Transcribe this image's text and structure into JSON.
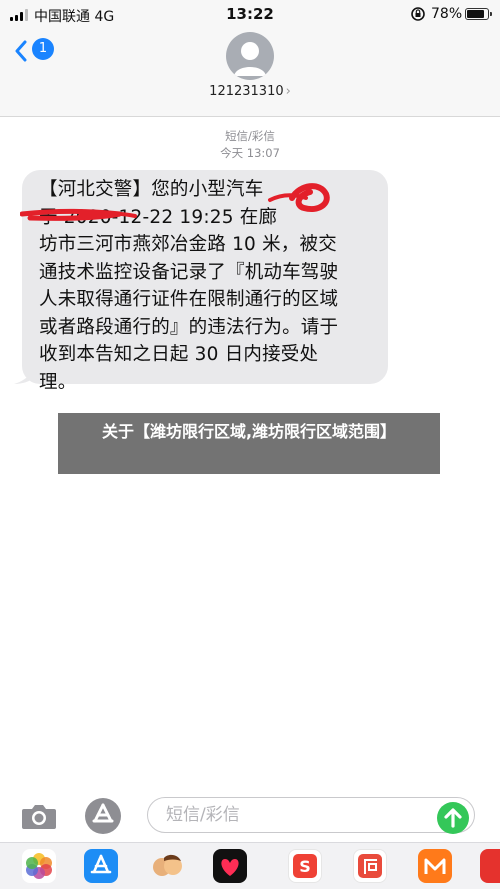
{
  "status_bar": {
    "carrier": "中国联通",
    "network": "4G",
    "time": "13:22",
    "battery": "78%",
    "battery_level": 0.78
  },
  "header": {
    "back_badge": "1",
    "contact_number": "121231310",
    "chevron": "›"
  },
  "conversation": {
    "service_label": "短信/彩信",
    "timestamp": "今天 13:07",
    "message_lines": [
      "【河北交警】您的小型汽车",
      "于 2020-12-22 19:25 在廊",
      "坊市三河市燕郊冶金路 10 米，被交",
      "通技术监控设备记录了『机动车驾驶",
      "人未取得通行证件在限制通行的区域",
      "或者路段通行的』的违法行为。请于",
      "收到本告知之日起 30 日内接受处",
      "理。"
    ]
  },
  "caption": {
    "text": "关于【潍坊限行区域,潍坊限行区域范围】"
  },
  "input_bar": {
    "placeholder": "短信/彩信"
  },
  "app_strip": [
    {
      "icon": "photos-icon"
    },
    {
      "icon": "app-store-icon"
    },
    {
      "icon": "memoji-icon"
    },
    {
      "icon": "digital-touch-icon"
    },
    {
      "icon": "app-s-icon"
    },
    {
      "icon": "xiachufang-icon"
    },
    {
      "icon": "mango-tv-icon"
    },
    {
      "icon": "app-red-icon"
    }
  ],
  "colors": {
    "accent": "#1a84ff",
    "bubble": "#e9e9eb",
    "send": "#34c759",
    "scribble": "#e3202a"
  }
}
